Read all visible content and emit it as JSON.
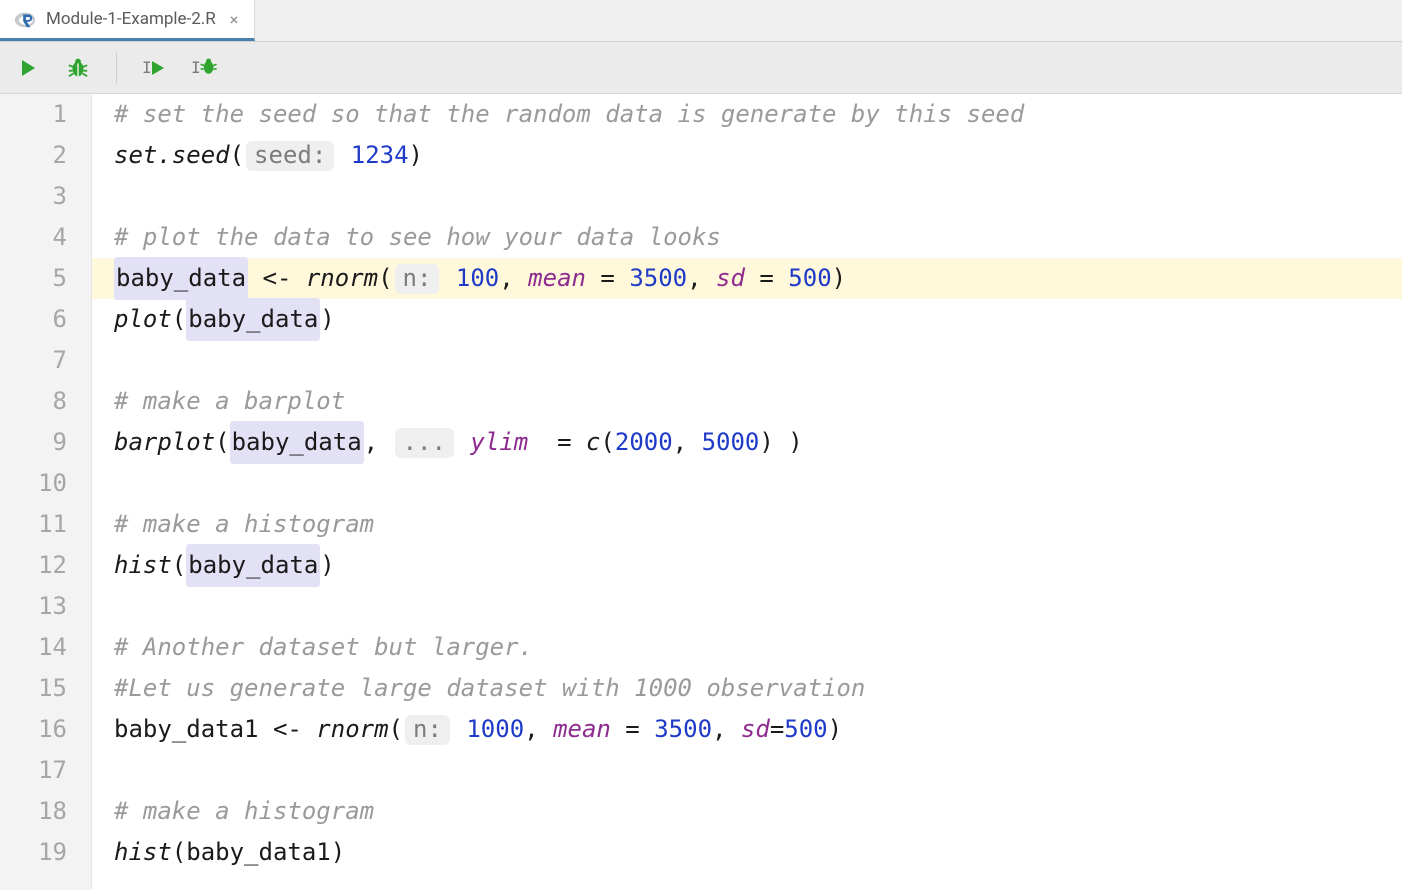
{
  "tab": {
    "filename": "Module-1-Example-2.R"
  },
  "icons": {
    "run": "run-icon",
    "bug": "bug-icon",
    "run_cursor": "run-cursor-icon",
    "bug_cursor": "bug-cursor-icon",
    "r_logo": "r-logo-icon",
    "close": "×"
  },
  "editor": {
    "highlighted_line": 5,
    "lines": [
      {
        "n": 1,
        "tokens": [
          {
            "t": "# set the seed so that the random data is generate by this seed",
            "c": "tk-comment"
          }
        ]
      },
      {
        "n": 2,
        "tokens": [
          {
            "t": "set.seed",
            "c": "tk-func"
          },
          {
            "t": "(",
            "c": "tk-op"
          },
          {
            "hint": true,
            "t": "seed:"
          },
          {
            "t": " "
          },
          {
            "t": "1234",
            "c": "tk-num"
          },
          {
            "t": ")",
            "c": "tk-op"
          }
        ]
      },
      {
        "n": 3,
        "tokens": []
      },
      {
        "n": 4,
        "tokens": [
          {
            "t": "# plot the data to see how your data looks",
            "c": "tk-comment"
          }
        ]
      },
      {
        "n": 5,
        "tokens": [
          {
            "t": "baby_data",
            "c": "tk-ident",
            "vh": true
          },
          {
            "t": " <- ",
            "c": "tk-op"
          },
          {
            "t": "rnorm",
            "c": "tk-func var-it"
          },
          {
            "t": "(",
            "c": "tk-op"
          },
          {
            "hint": true,
            "t": "n:"
          },
          {
            "t": " "
          },
          {
            "t": "100",
            "c": "tk-num"
          },
          {
            "t": ", ",
            "c": "tk-op"
          },
          {
            "t": "mean",
            "c": "tk-param"
          },
          {
            "t": " = ",
            "c": "tk-op"
          },
          {
            "t": "3500",
            "c": "tk-num"
          },
          {
            "t": ", ",
            "c": "tk-op"
          },
          {
            "t": "sd",
            "c": "tk-param"
          },
          {
            "t": " = ",
            "c": "tk-op"
          },
          {
            "t": "500",
            "c": "tk-num"
          },
          {
            "t": ")",
            "c": "tk-op"
          }
        ]
      },
      {
        "n": 6,
        "tokens": [
          {
            "t": "plot",
            "c": "tk-func"
          },
          {
            "t": "(",
            "c": "tk-op"
          },
          {
            "t": "baby_data",
            "c": "tk-ident",
            "vh": true
          },
          {
            "t": ")",
            "c": "tk-op"
          }
        ]
      },
      {
        "n": 7,
        "tokens": []
      },
      {
        "n": 8,
        "tokens": [
          {
            "t": "# make a barplot",
            "c": "tk-comment"
          }
        ]
      },
      {
        "n": 9,
        "tokens": [
          {
            "t": "barplot",
            "c": "tk-func"
          },
          {
            "t": "(",
            "c": "tk-op"
          },
          {
            "t": "baby_data",
            "c": "tk-ident",
            "vh": true
          },
          {
            "t": ", ",
            "c": "tk-op"
          },
          {
            "hint": true,
            "t": "..."
          },
          {
            "t": " "
          },
          {
            "t": "ylim",
            "c": "tk-param"
          },
          {
            "t": "  = ",
            "c": "tk-op"
          },
          {
            "t": "c",
            "c": "tk-func"
          },
          {
            "t": "(",
            "c": "tk-op"
          },
          {
            "t": "2000",
            "c": "tk-num"
          },
          {
            "t": ", ",
            "c": "tk-op"
          },
          {
            "t": "5000",
            "c": "tk-num"
          },
          {
            "t": ") )",
            "c": "tk-op"
          }
        ]
      },
      {
        "n": 10,
        "tokens": []
      },
      {
        "n": 11,
        "tokens": [
          {
            "t": "# make a histogram",
            "c": "tk-comment"
          }
        ]
      },
      {
        "n": 12,
        "tokens": [
          {
            "t": "hist",
            "c": "tk-func"
          },
          {
            "t": "(",
            "c": "tk-op"
          },
          {
            "t": "baby_data",
            "c": "tk-ident",
            "vh": true
          },
          {
            "t": ")",
            "c": "tk-op"
          }
        ]
      },
      {
        "n": 13,
        "tokens": []
      },
      {
        "n": 14,
        "tokens": [
          {
            "t": "# Another dataset but larger.",
            "c": "tk-comment"
          }
        ]
      },
      {
        "n": 15,
        "tokens": [
          {
            "t": "#Let us generate large dataset with 1000 observation",
            "c": "tk-comment"
          }
        ]
      },
      {
        "n": 16,
        "tokens": [
          {
            "t": "baby_data1",
            "c": "tk-ident"
          },
          {
            "t": " <- ",
            "c": "tk-op"
          },
          {
            "t": "rnorm",
            "c": "tk-func"
          },
          {
            "t": "(",
            "c": "tk-op"
          },
          {
            "hint": true,
            "t": "n:"
          },
          {
            "t": " "
          },
          {
            "t": "1000",
            "c": "tk-num"
          },
          {
            "t": ", ",
            "c": "tk-op"
          },
          {
            "t": "mean",
            "c": "tk-param"
          },
          {
            "t": " = ",
            "c": "tk-op"
          },
          {
            "t": "3500",
            "c": "tk-num"
          },
          {
            "t": ", ",
            "c": "tk-op"
          },
          {
            "t": "sd",
            "c": "tk-param"
          },
          {
            "t": "=",
            "c": "tk-op"
          },
          {
            "t": "500",
            "c": "tk-num"
          },
          {
            "t": ")",
            "c": "tk-op"
          }
        ]
      },
      {
        "n": 17,
        "tokens": []
      },
      {
        "n": 18,
        "tokens": [
          {
            "t": "# make a histogram",
            "c": "tk-comment"
          }
        ]
      },
      {
        "n": 19,
        "tokens": [
          {
            "t": "hist",
            "c": "tk-func"
          },
          {
            "t": "(",
            "c": "tk-op"
          },
          {
            "t": "baby_data1",
            "c": "tk-ident"
          },
          {
            "t": ")",
            "c": "tk-op"
          }
        ]
      }
    ]
  }
}
